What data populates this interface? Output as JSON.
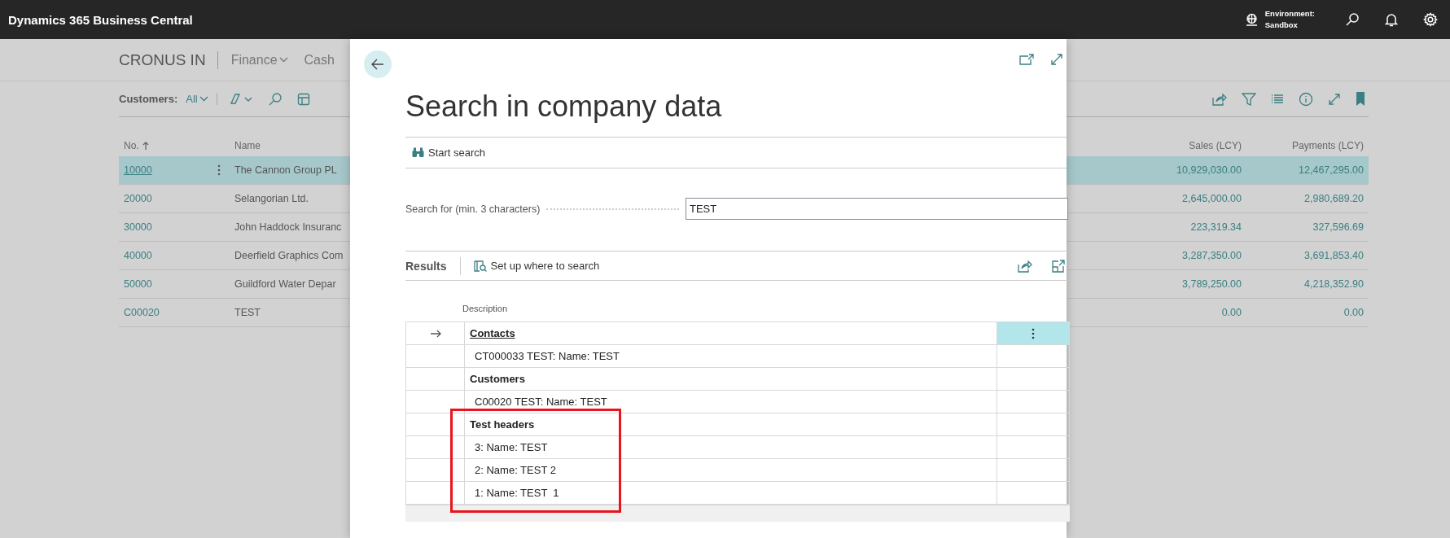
{
  "app_bar": {
    "title": "Dynamics 365 Business Central",
    "environment_label": "Environment:",
    "environment_name": "Sandbox"
  },
  "background_page": {
    "company": "CRONUS IN",
    "nav": [
      "Finance",
      "Cash"
    ],
    "list_label": "Customers:",
    "filter": "All",
    "columns": [
      "No.",
      "Name",
      "Sales (LCY)",
      "Payments (LCY)"
    ],
    "rows": [
      {
        "no": "10000",
        "name": "The Cannon Group PL",
        "sales": "10,929,030.00",
        "payments": "12,467,295.00",
        "selected": true
      },
      {
        "no": "20000",
        "name": "Selangorian Ltd.",
        "sales": "2,645,000.00",
        "payments": "2,980,689.20",
        "selected": false
      },
      {
        "no": "30000",
        "name": "John Haddock Insuranc",
        "sales": "223,319.34",
        "payments": "327,596.69",
        "selected": false
      },
      {
        "no": "40000",
        "name": "Deerfield Graphics Com",
        "sales": "3,287,350.00",
        "payments": "3,691,853.40",
        "selected": false
      },
      {
        "no": "50000",
        "name": "Guildford Water Depar",
        "sales": "3,789,250.00",
        "payments": "4,218,352.90",
        "selected": false
      },
      {
        "no": "C00020",
        "name": "TEST",
        "sales": "0.00",
        "payments": "0.00",
        "selected": false
      }
    ]
  },
  "dialog": {
    "title": "Search in company data",
    "action": "Start search",
    "search_label": "Search for (min. 3 characters)",
    "search_value": "TEST",
    "results_title": "Results",
    "results_action": "Set up where to search",
    "column": "Description",
    "results": [
      {
        "kind": "group",
        "text": "Contacts",
        "selected": true
      },
      {
        "kind": "record",
        "text": "CT000033 TEST: Name: TEST",
        "selected": false
      },
      {
        "kind": "group",
        "text": "Customers",
        "selected": false
      },
      {
        "kind": "record",
        "text": "C00020 TEST: Name: TEST",
        "selected": false
      },
      {
        "kind": "group",
        "text": "Test headers",
        "selected": false
      },
      {
        "kind": "record",
        "text": "3: Name: TEST",
        "selected": false
      },
      {
        "kind": "record",
        "text": "2: Name: TEST 2",
        "selected": false
      },
      {
        "kind": "record",
        "text": "1: Name: TEST  1",
        "selected": false
      }
    ]
  }
}
